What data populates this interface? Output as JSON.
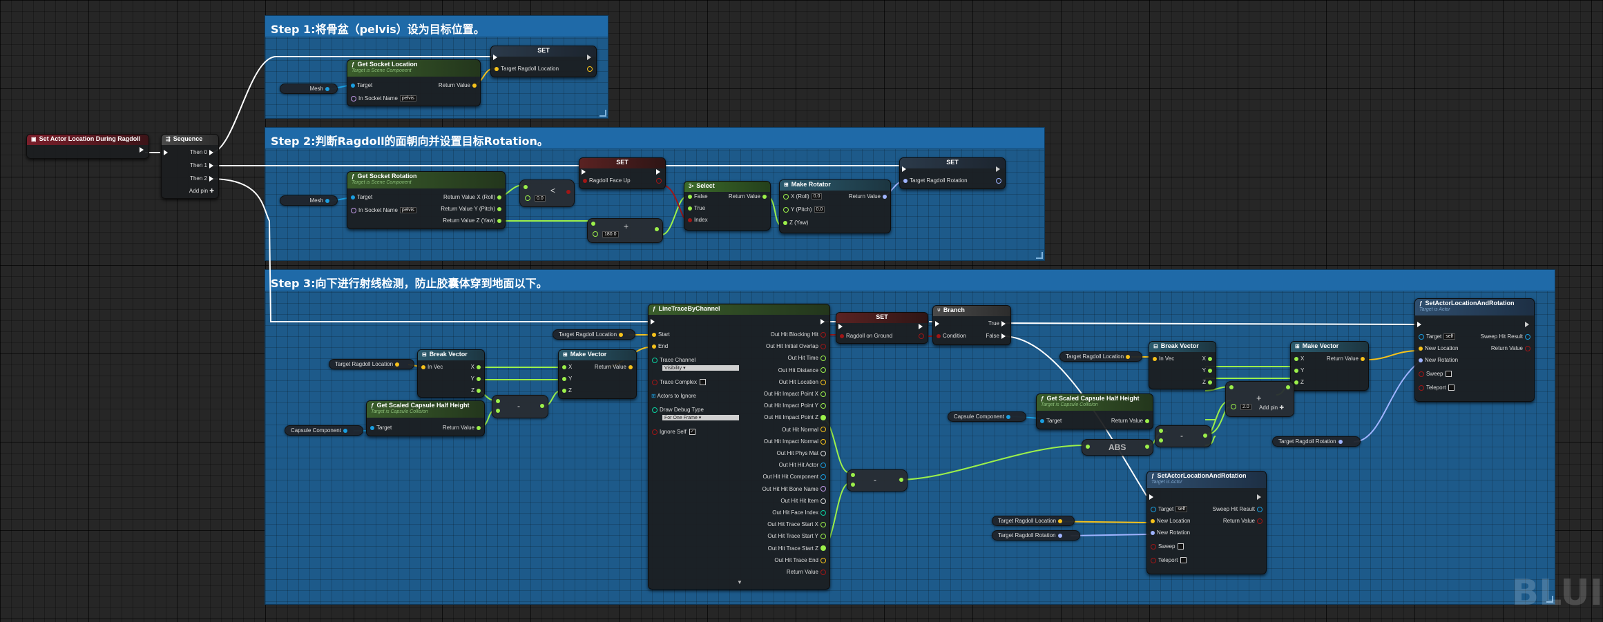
{
  "comments": {
    "step1": "Step 1:将骨盆（pelvis）设为目标位置。",
    "step2": "Step 2:判断Ragdoll的面朝向并设置目标Rotation。",
    "step3": "Step 3:向下进行射线检测，防止胶囊体穿到地面以下。"
  },
  "event": {
    "title": "Set Actor Location During Ragdoll"
  },
  "sequence": {
    "title": "Sequence",
    "then0": "Then 0",
    "then1": "Then 1",
    "then2": "Then 2",
    "add_pin": "Add pin"
  },
  "step1": {
    "set_title": "SET",
    "set_pin": "Target Ragdoll Location",
    "mesh": "Mesh",
    "socket": {
      "title": "Get Socket Location",
      "sub": "Target is Scene Component",
      "target": "Target",
      "socket_name": "In Socket Name",
      "socket_value": "pelvis",
      "return": "Return Value"
    }
  },
  "step2": {
    "mesh": "Mesh",
    "rot": {
      "title": "Get Socket Rotation",
      "sub": "Target is Scene Component",
      "target": "Target",
      "socket_name": "In Socket Name",
      "socket_value": "pelvis",
      "roll": "Return Value X (Roll)",
      "pitch": "Return Value Y (Pitch)",
      "yaw": "Return Value Z (Yaw)"
    },
    "less": {
      "symbol": "<",
      "value": "0.0"
    },
    "add": {
      "symbol": "+",
      "value": "180.0"
    },
    "set_face": {
      "title": "SET",
      "pin": "Ragdoll Face Up"
    },
    "select": {
      "title": "Select",
      "false": "False",
      "true": "True",
      "index": "Index",
      "return": "Return Value"
    },
    "make_rot": {
      "title": "Make Rotator",
      "x": "X (Roll)",
      "x_val": "0.0",
      "y": "Y (Pitch)",
      "y_val": "0.0",
      "z": "Z (Yaw)",
      "return": "Return Value"
    },
    "set_rot": {
      "title": "SET",
      "pin": "Target Ragdoll Rotation"
    }
  },
  "step3": {
    "target_loc_1": "Target Ragdoll Location",
    "target_loc_2": "Target Ragdoll Location",
    "break1": {
      "title": "Break Vector",
      "in": "In Vec",
      "x": "X",
      "y": "Y",
      "z": "Z"
    },
    "make1": {
      "title": "Make Vector",
      "x": "X",
      "y": "Y",
      "z": "Z",
      "return": "Return Value"
    },
    "minus1": "-",
    "half1": {
      "title": "Get Scaled Capsule Half Height",
      "sub": "Target is Capsule Collision",
      "target": "Target",
      "return": "Return Value"
    },
    "capsule1": "Capsule Component",
    "trace": {
      "title": "LineTraceByChannel",
      "start": "Start",
      "end": "End",
      "channel_label": "Trace Channel",
      "channel_value": "Visibility",
      "complex": "Trace Complex",
      "ignore": "Actors to Ignore",
      "debug_label": "Draw Debug Type",
      "debug_value": "For One Frame",
      "ignore_self": "Ignore Self",
      "outs": [
        "Out Hit Blocking Hit",
        "Out Hit Initial Overlap",
        "Out Hit Time",
        "Out Hit Distance",
        "Out Hit Location",
        "Out Hit Impact Point X",
        "Out Hit Impact Point Y",
        "Out Hit Impact Point Z",
        "Out Hit Normal",
        "Out Hit Impact Normal",
        "Out Hit Phys Mat",
        "Out Hit Hit Actor",
        "Out Hit Hit Component",
        "Out Hit Hit Bone Name",
        "Out Hit Hit Item",
        "Out Hit Face Index",
        "Out Hit Trace Start X",
        "Out Hit Trace Start Y",
        "Out Hit Trace Start Z",
        "Out Hit Trace End",
        "Return Value"
      ]
    },
    "set_ground": {
      "title": "SET",
      "pin": "Ragdoll on Ground"
    },
    "branch": {
      "title": "Branch",
      "condition": "Condition",
      "true": "True",
      "false": "False"
    },
    "target_loc_3": "Target Ragdoll Location",
    "break2": {
      "title": "Break Vector",
      "in": "In Vec",
      "x": "X",
      "y": "Y",
      "z": "Z"
    },
    "make2": {
      "title": "Make Vector",
      "x": "X",
      "y": "Y",
      "z": "Z",
      "return": "Return Value"
    },
    "add_node": {
      "symbol": "+",
      "value": "2.0",
      "add_pin": "Add pin"
    },
    "half2": {
      "title": "Get Scaled Capsule Half Height",
      "sub": "Target is Capsule Collision",
      "target": "Target",
      "return": "Return Value"
    },
    "capsule2": "Capsule Component",
    "minus2": "-",
    "minus3": "-",
    "abs": "ABS",
    "target_rot_1": "Target Ragdoll Rotation",
    "target_loc_4": "Target Ragdoll Location",
    "target_rot_2": "Target Ragdoll Rotation",
    "setloc1": {
      "title": "SetActorLocationAndRotation",
      "sub": "Target is Actor",
      "target": "Target",
      "target_val": "self",
      "newloc": "New Location",
      "newrot": "New Rotation",
      "sweep": "Sweep",
      "teleport": "Teleport",
      "hit": "Sweep Hit Result",
      "return": "Return Value"
    },
    "setloc2": {
      "title": "SetActorLocationAndRotation",
      "sub": "Target is Actor",
      "target": "Target",
      "target_val": "self",
      "newloc": "New Location",
      "newrot": "New Rotation",
      "sweep": "Sweep",
      "teleport": "Teleport",
      "hit": "Sweep Hit Result",
      "return": "Return Value"
    }
  },
  "watermark": "BLUI",
  "colors": {
    "exec": "#ffffff",
    "vector": "#f7c21b",
    "float": "#9cf04a",
    "bool": "#a01616",
    "rotator": "#a0b4ff",
    "object": "#1a9ee0",
    "comment": "#1d5a8a"
  }
}
